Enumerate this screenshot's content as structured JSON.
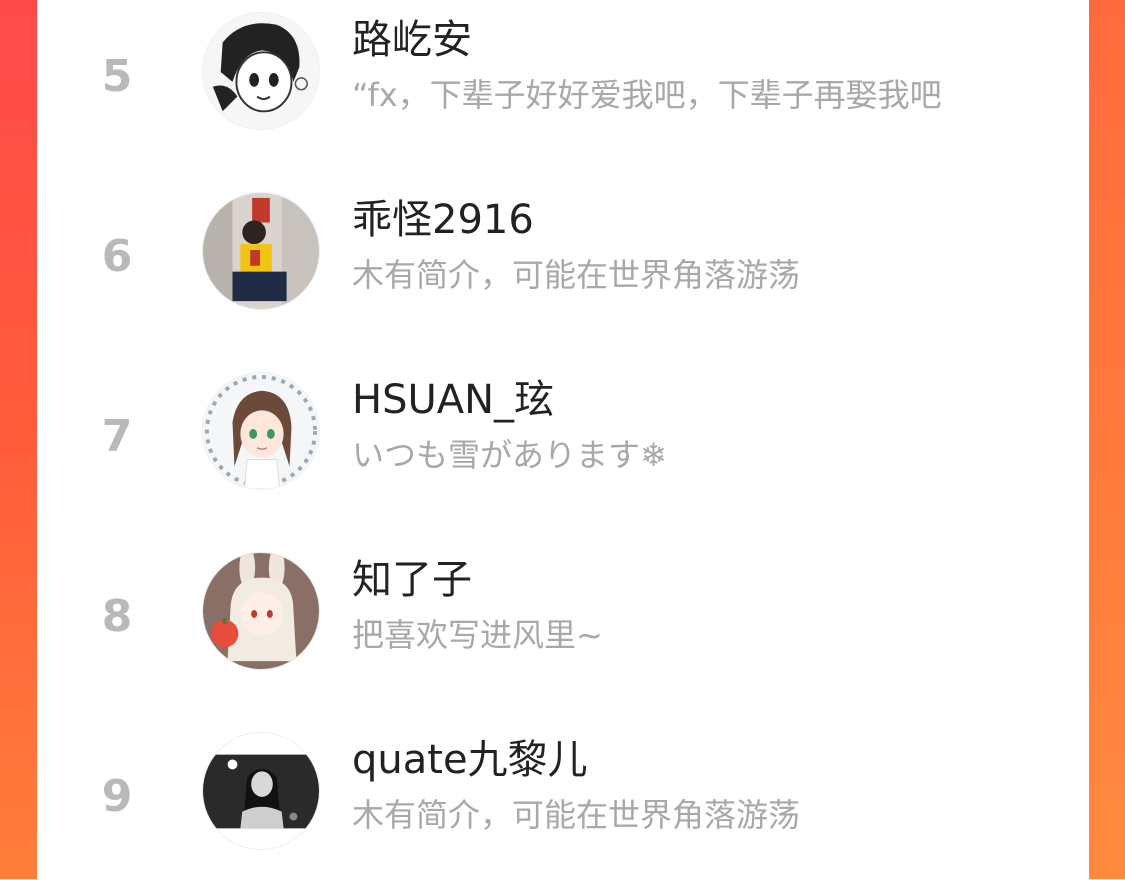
{
  "colors": {
    "accent_gradient_top": "#ff4a4a",
    "accent_gradient_bottom": "#ff7e3a",
    "rank_color": "#b9b9b9",
    "name_color": "#222222",
    "bio_color": "#a8a8a8"
  },
  "list": {
    "items": [
      {
        "rank": "5",
        "name": "路屹安",
        "bio": "“fx，下辈子好好爱我吧，下辈子再娶我吧",
        "avatar": "anime-girl-sketch-avatar"
      },
      {
        "rank": "6",
        "name": "乖怪2916",
        "bio": "木有简介，可能在世界角落游荡",
        "avatar": "girl-photo-avatar"
      },
      {
        "rank": "7",
        "name": "HSUAN_玹",
        "bio": "いつも雪があります❄",
        "avatar": "anime-girl-snow-avatar"
      },
      {
        "rank": "8",
        "name": "知了子",
        "bio": "把喜欢写进风里~",
        "avatar": "anime-bunny-girl-avatar"
      },
      {
        "rank": "9",
        "name": "quate九黎儿",
        "bio": "木有简介，可能在世界角落游荡",
        "avatar": "monochrome-girl-photo-avatar"
      }
    ]
  }
}
